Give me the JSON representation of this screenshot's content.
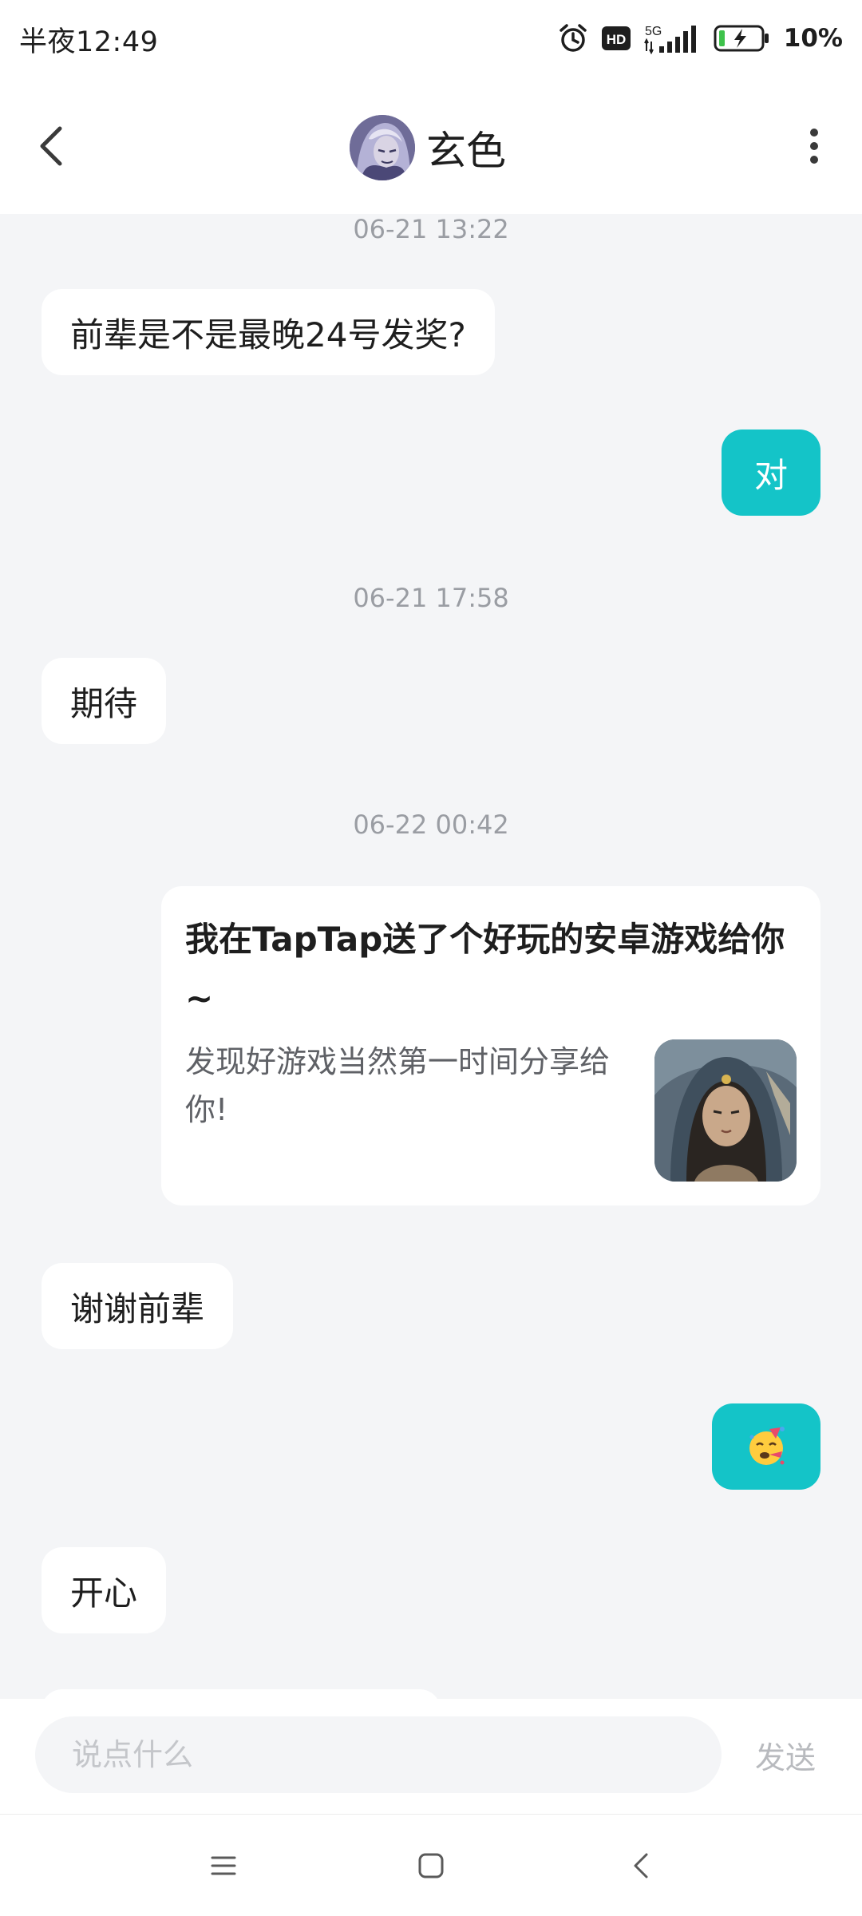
{
  "status_bar": {
    "time": "半夜12:49",
    "network": "5G",
    "hd_badge": "HD",
    "battery": "10%",
    "icons": [
      "alarm-icon",
      "hd-icon",
      "5g-signal-icon",
      "battery-charging-icon"
    ]
  },
  "header": {
    "title": "玄色",
    "back_icon": "chevron-left-icon",
    "more_icon": "more-vertical-icon"
  },
  "messages": [
    {
      "type": "timestamp",
      "text": "06-21 13:22"
    },
    {
      "type": "incoming",
      "text": "前辈是不是最晚24号发奖?"
    },
    {
      "type": "outgoing",
      "text": "对"
    },
    {
      "type": "timestamp",
      "text": "06-21 17:58"
    },
    {
      "type": "incoming",
      "text": "期待"
    },
    {
      "type": "timestamp",
      "text": "06-22 00:42"
    },
    {
      "type": "outgoing_card",
      "title": "我在TapTap送了个好玩的安卓游戏给你~",
      "description": "发现好游戏当然第一时间分享给你!"
    },
    {
      "type": "incoming",
      "text": "谢谢前辈"
    },
    {
      "type": "outgoing",
      "text": "🥳"
    },
    {
      "type": "incoming",
      "text": "开心"
    }
  ],
  "input": {
    "placeholder": "说点什么",
    "value": "",
    "send_label": "发送"
  },
  "nav_bar": {
    "icons": [
      "menu-icon",
      "home-square-icon",
      "back-icon"
    ]
  },
  "colors": {
    "outgoing_bubble": "#14c4c8",
    "incoming_bubble": "#ffffff",
    "chat_background": "#f4f5f7",
    "timestamp_text": "#9a9da3"
  }
}
